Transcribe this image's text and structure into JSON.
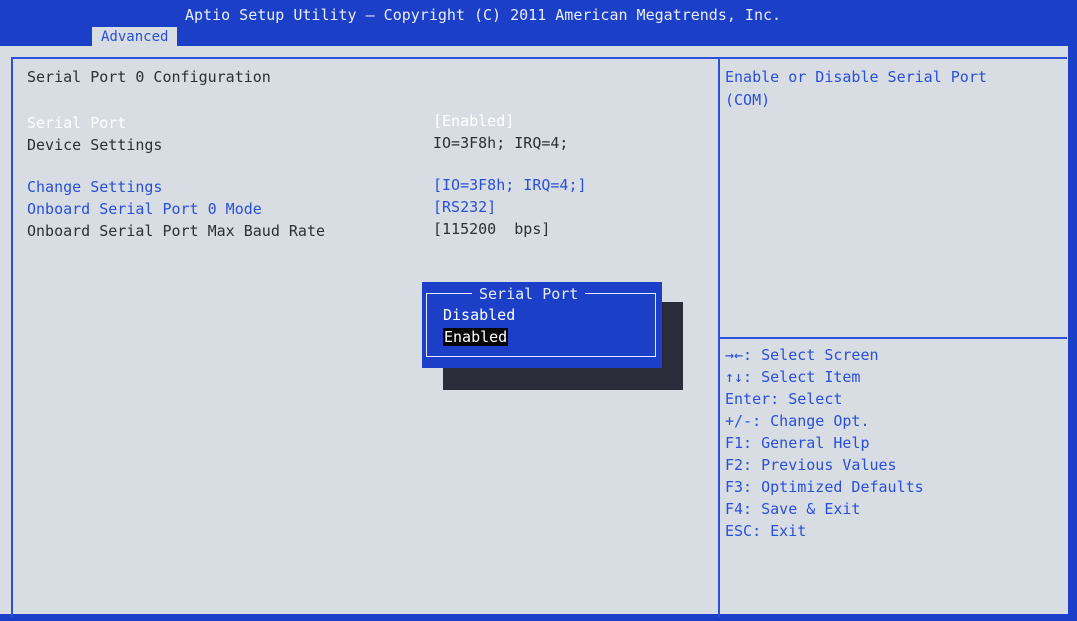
{
  "header": {
    "title": "Aptio Setup Utility – Copyright (C) 2011 American Megatrends, Inc.",
    "tab": "Advanced"
  },
  "main": {
    "section_title": "Serial Port 0 Configuration",
    "rows": [
      {
        "label": "Serial Port",
        "value": "[Enabled]"
      },
      {
        "label": "Device Settings",
        "value": "IO=3F8h; IRQ=4;"
      },
      {
        "label": "Change Settings",
        "value": "[IO=3F8h; IRQ=4;]"
      },
      {
        "label": "Onboard Serial Port 0 Mode",
        "value": "[RS232]"
      },
      {
        "label": "Onboard Serial Port Max Baud Rate",
        "value": "[115200  bps]"
      }
    ]
  },
  "help": {
    "description_line1": "Enable or Disable Serial Port",
    "description_line2": "(COM)",
    "keys": [
      "→←: Select Screen",
      "↑↓: Select Item",
      "Enter: Select",
      "+/-: Change Opt.",
      "F1: General Help",
      "F2: Previous Values",
      "F3: Optimized Defaults",
      "F4: Save & Exit",
      "ESC: Exit"
    ]
  },
  "popup": {
    "title": "Serial Port",
    "options": [
      "Disabled",
      "Enabled"
    ],
    "selected": "Enabled"
  },
  "colors": {
    "bios_blue": "#1c3fc8",
    "highlight_blue": "#2a4fd8",
    "background": "#d7dde3",
    "text": "#2c2f36"
  }
}
